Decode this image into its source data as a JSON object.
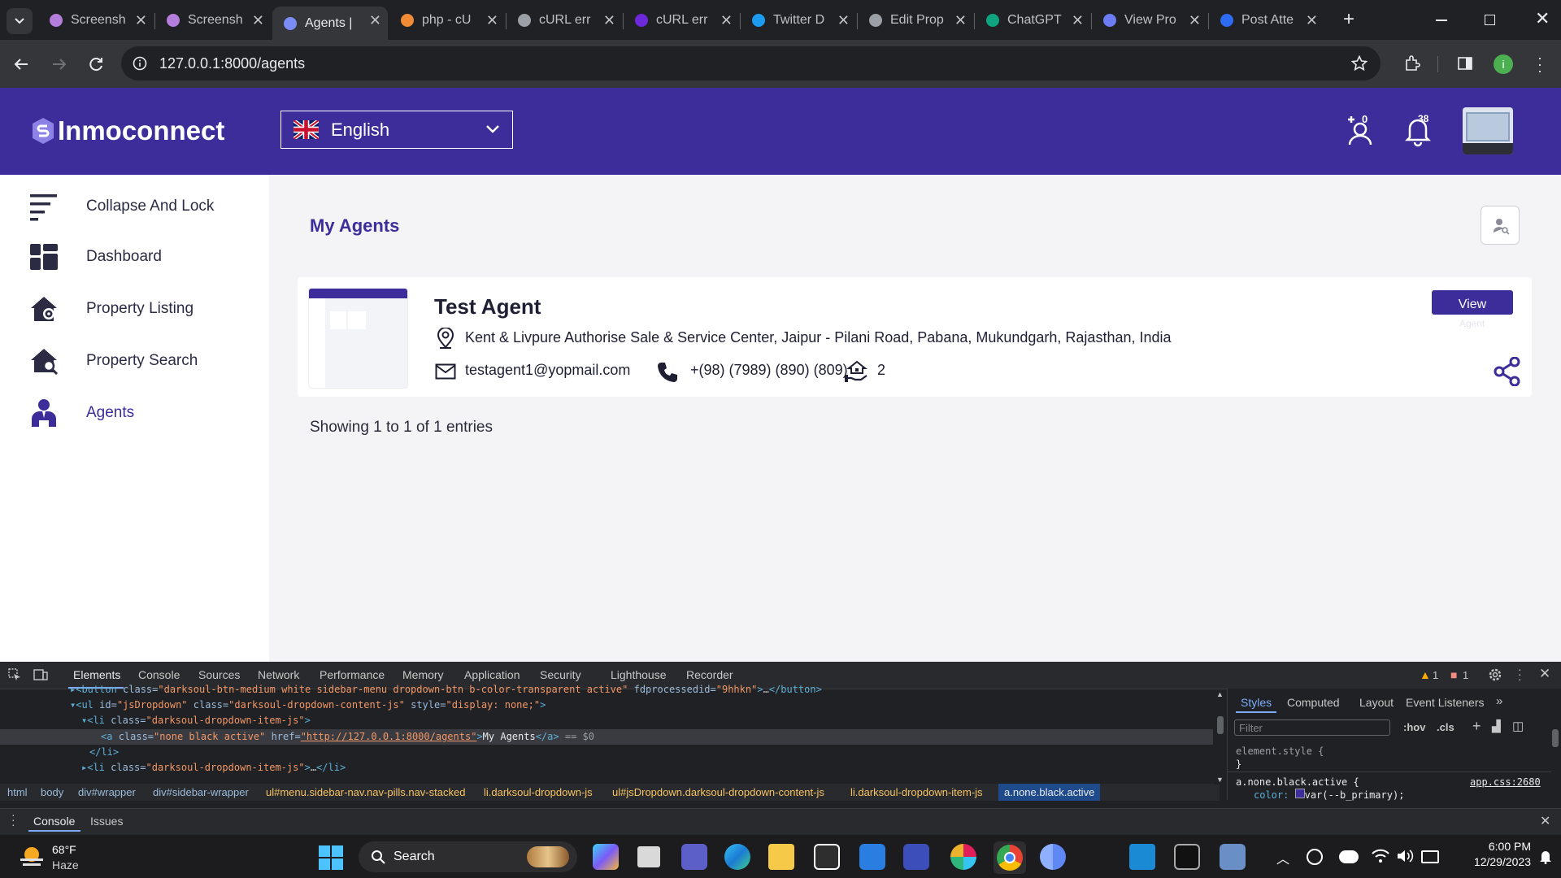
{
  "browser": {
    "tabs": [
      {
        "title": "Screensh",
        "active": false
      },
      {
        "title": "Screensh",
        "active": false
      },
      {
        "title": "Agents |",
        "active": true
      },
      {
        "title": "php - cU",
        "active": false
      },
      {
        "title": "cURL err",
        "active": false
      },
      {
        "title": "cURL err",
        "active": false
      },
      {
        "title": "Twitter D",
        "active": false
      },
      {
        "title": "Edit Prop",
        "active": false
      },
      {
        "title": "ChatGPT",
        "active": false
      },
      {
        "title": "View Pro",
        "active": false
      },
      {
        "title": "Post Atte",
        "active": false
      }
    ],
    "url": "127.0.0.1:8000/agents"
  },
  "header": {
    "logo_text": "Inmoconnect",
    "language": "English",
    "notif_count": "38",
    "add_user_count": "0"
  },
  "sidebar": {
    "items": [
      {
        "label": "Collapse And Lock",
        "icon": "menu-lines-icon"
      },
      {
        "label": "Dashboard",
        "icon": "dashboard-icon"
      },
      {
        "label": "Property Listing",
        "icon": "house-gear-icon"
      },
      {
        "label": "Property Search",
        "icon": "house-search-icon"
      },
      {
        "label": "Agents",
        "icon": "agent-icon"
      }
    ]
  },
  "main": {
    "title": "My Agents",
    "agent": {
      "name": "Test Agent",
      "address": "Kent & Livpure Authorise Sale & Service Center, Jaipur - Pilani Road, Pabana, Mukundgarh, Rajasthan, India",
      "email": "testagent1@yopmail.com",
      "phone": "+(98) (7989) (890) (809)",
      "properties": "2",
      "view_label": "View",
      "view_sub": "Agent"
    },
    "entries": "Showing 1 to 1 of 1 entries"
  },
  "devtools": {
    "tabs": [
      "Elements",
      "Console",
      "Sources",
      "Network",
      "Performance",
      "Memory",
      "Application",
      "Security",
      "Lighthouse",
      "Recorder"
    ],
    "warnings": "1",
    "errors": "1",
    "breadcrumbs": [
      "html",
      "body",
      "div#wrapper",
      "div#sidebar-wrapper",
      "ul#menu.sidebar-nav.nav-pills.nav-stacked",
      "li.darksoul-dropdown-js",
      "ul#jsDropdown.darksoul-dropdown-content-js",
      "li.darksoul-dropdown-item-js",
      "a.none.black.active"
    ],
    "style_tabs": [
      "Styles",
      "Computed",
      "Layout",
      "Event Listeners"
    ],
    "filter_placeholder": "Filter",
    "hov": ":hov",
    "cls": ".cls",
    "element_style": "element.style {",
    "rule_selector": "a.none.black.active {",
    "rule_source": "app.css:2680",
    "rule_prop": "color:",
    "rule_value": "var(--b_primary);",
    "drawer_tabs": [
      "Console",
      "Issues"
    ]
  },
  "taskbar": {
    "weather_temp": "68°F",
    "weather_desc": "Haze",
    "search_label": "Search",
    "time": "6:00 PM",
    "date": "12/29/2023"
  }
}
